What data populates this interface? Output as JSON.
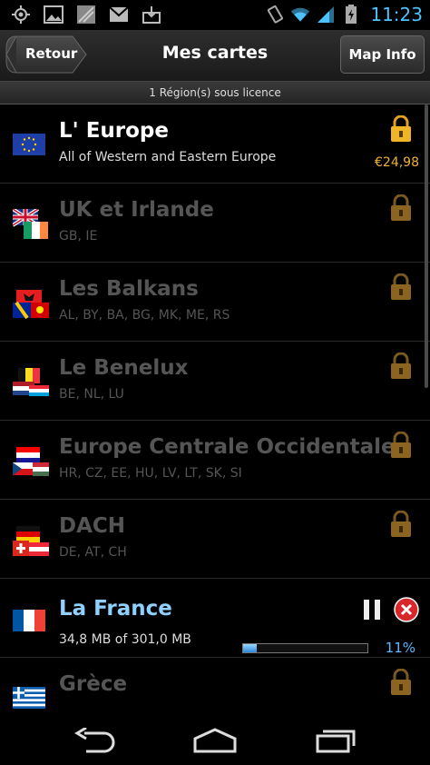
{
  "status_bar": {
    "time": "11:23",
    "icons": [
      "gps-icon",
      "image-icon",
      "gallery-icon",
      "gmail-icon",
      "download-icon",
      "vibrate-icon",
      "wifi-icon",
      "signal-icon",
      "battery-charging-icon"
    ]
  },
  "header": {
    "back_label": "Retour",
    "title": "Mes cartes",
    "info_label": "Map Info"
  },
  "subheader": {
    "text": "1 Région(s) sous licence"
  },
  "maps": [
    {
      "title": "L' Europe",
      "subtitle": "All of Western and Eastern Europe",
      "state": "active",
      "price": "€24,98",
      "flag": "eu"
    },
    {
      "title": "UK et Irlande",
      "subtitle": "GB, IE",
      "state": "locked",
      "flag": "uk-ie"
    },
    {
      "title": "Les Balkans",
      "subtitle": "AL, BY, BA, BG, MK, ME, RS",
      "state": "locked",
      "flag": "balkans"
    },
    {
      "title": "Le Benelux",
      "subtitle": "BE, NL, LU",
      "state": "locked",
      "flag": "benelux"
    },
    {
      "title": "Europe Centrale Occidentale",
      "subtitle": "HR, CZ, EE, HU, LV, LT, SK, SI",
      "state": "locked",
      "flag": "central"
    },
    {
      "title": "DACH",
      "subtitle": "DE, AT, CH",
      "state": "locked",
      "flag": "dach"
    },
    {
      "title": "La France",
      "subtitle": "34,8 MB of 301,0 MB",
      "state": "downloading",
      "progress_percent": 11,
      "progress_label": "11%",
      "flag": "fr"
    },
    {
      "title": "Grèce",
      "subtitle": "",
      "state": "locked",
      "flag": "gr"
    }
  ],
  "colors": {
    "accent_blue": "#4cc3ff",
    "price": "#f0b030",
    "lock_gold": "#e8a020"
  }
}
